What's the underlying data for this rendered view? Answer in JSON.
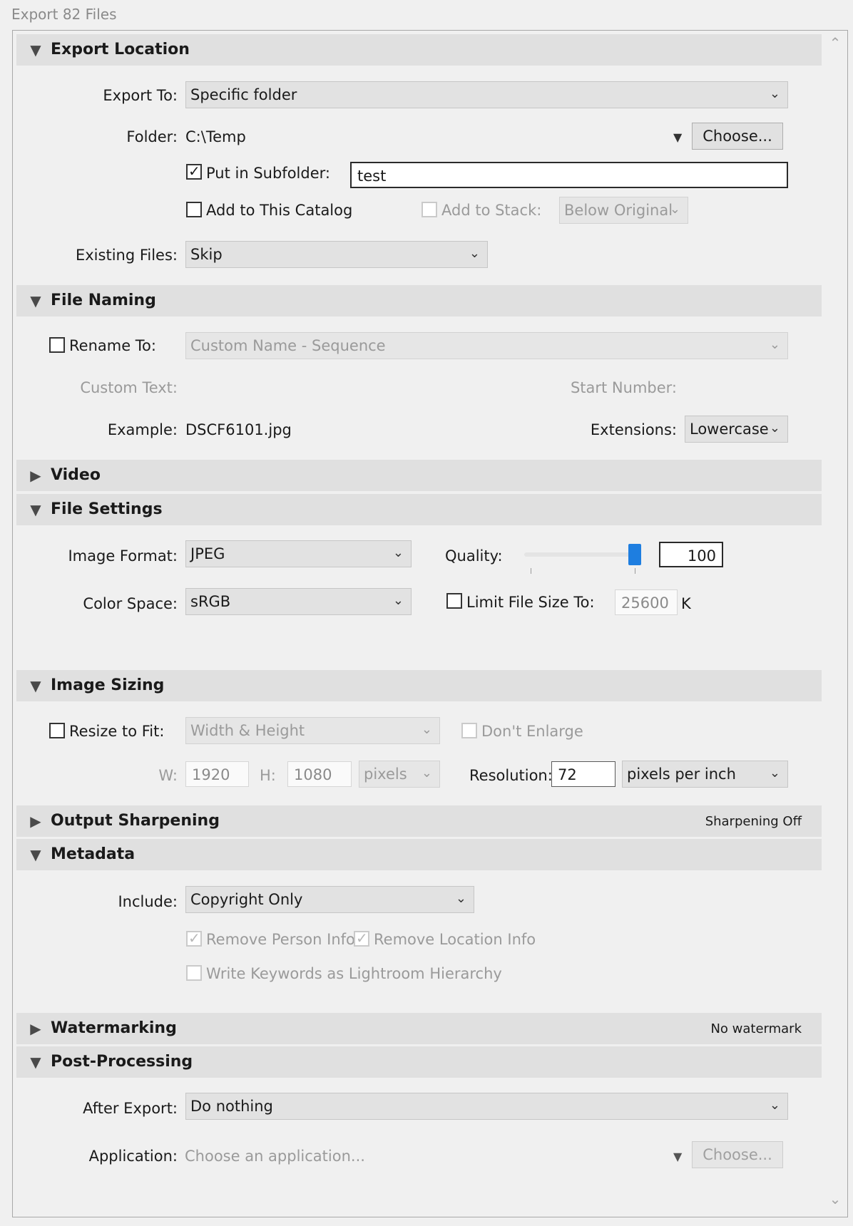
{
  "window_title": "Export 82 Files",
  "sections": {
    "export_location": {
      "title": "Export Location"
    },
    "file_naming": {
      "title": "File Naming"
    },
    "video": {
      "title": "Video"
    },
    "file_settings": {
      "title": "File Settings"
    },
    "image_sizing": {
      "title": "Image Sizing"
    },
    "output_sharpening": {
      "title": "Output Sharpening",
      "status": "Sharpening Off"
    },
    "metadata": {
      "title": "Metadata"
    },
    "watermarking": {
      "title": "Watermarking",
      "status": "No watermark"
    },
    "post_processing": {
      "title": "Post-Processing"
    }
  },
  "export_location": {
    "export_to_label": "Export To:",
    "export_to_value": "Specific folder",
    "folder_label": "Folder:",
    "folder_value": "C:\\Temp",
    "choose_label": "Choose...",
    "subfolder_label": "Put in Subfolder:",
    "subfolder_checked": true,
    "subfolder_value": "test",
    "add_catalog_label": "Add to This Catalog",
    "add_stack_label": "Add to Stack:",
    "stack_value": "Below Original",
    "existing_files_label": "Existing Files:",
    "existing_files_value": "Skip"
  },
  "file_naming": {
    "rename_label": "Rename To:",
    "rename_value": "Custom Name - Sequence",
    "custom_text_label": "Custom Text:",
    "start_number_label": "Start Number:",
    "example_label": "Example:",
    "example_value": "DSCF6101.jpg",
    "extensions_label": "Extensions:",
    "extensions_value": "Lowercase"
  },
  "file_settings": {
    "image_format_label": "Image Format:",
    "image_format_value": "JPEG",
    "quality_label": "Quality:",
    "quality_value": "100",
    "color_space_label": "Color Space:",
    "color_space_value": "sRGB",
    "limit_label": "Limit File Size To:",
    "limit_value": "25600",
    "limit_unit": "K"
  },
  "image_sizing": {
    "resize_label": "Resize to Fit:",
    "resize_value": "Width & Height",
    "dont_enlarge_label": "Don't Enlarge",
    "w_label": "W:",
    "w_value": "1920",
    "h_label": "H:",
    "h_value": "1080",
    "unit_value": "pixels",
    "resolution_label": "Resolution:",
    "resolution_value": "72",
    "resolution_unit": "pixels per inch"
  },
  "metadata": {
    "include_label": "Include:",
    "include_value": "Copyright Only",
    "remove_person_label": "Remove Person Info",
    "remove_location_label": "Remove Location Info",
    "write_keywords_label": "Write Keywords as Lightroom Hierarchy"
  },
  "post_processing": {
    "after_export_label": "After Export:",
    "after_export_value": "Do nothing",
    "application_label": "Application:",
    "application_placeholder": "Choose an application...",
    "choose_label": "Choose..."
  }
}
